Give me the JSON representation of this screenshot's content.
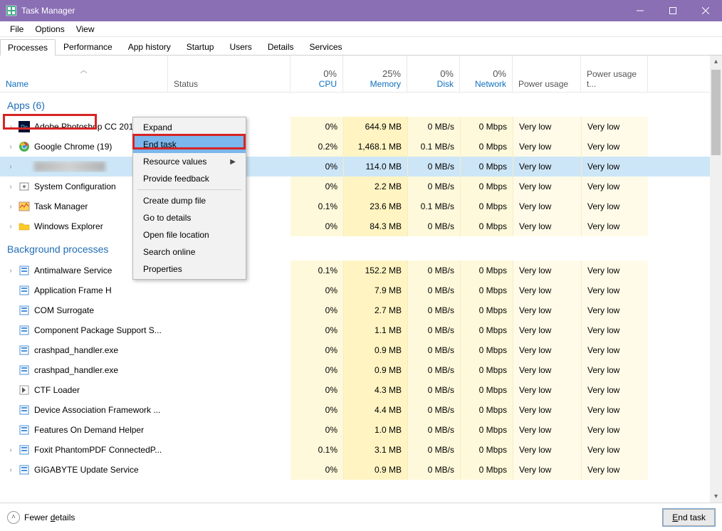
{
  "window": {
    "title": "Task Manager"
  },
  "menu": {
    "file": "File",
    "options": "Options",
    "view": "View"
  },
  "tabs": {
    "processes": "Processes",
    "performance": "Performance",
    "apphistory": "App history",
    "startup": "Startup",
    "users": "Users",
    "details": "Details",
    "services": "Services"
  },
  "columns": {
    "name": "Name",
    "status": "Status",
    "cpu": {
      "pct": "0%",
      "label": "CPU"
    },
    "memory": {
      "pct": "25%",
      "label": "Memory"
    },
    "disk": {
      "pct": "0%",
      "label": "Disk"
    },
    "network": {
      "pct": "0%",
      "label": "Network"
    },
    "power": "Power usage",
    "powertrend": "Power usage t..."
  },
  "groups": {
    "apps": "Apps (6)",
    "bg": "Background processes"
  },
  "rows": {
    "apps": [
      {
        "name": "Adobe Photoshop CC 2014 (2)",
        "cpu": "0%",
        "mem": "644.9 MB",
        "disk": "0 MB/s",
        "net": "0 Mbps",
        "pu": "Very low",
        "put": "Very low",
        "expand": true,
        "icon": "ps"
      },
      {
        "name": "Google Chrome (19)",
        "cpu": "0.2%",
        "mem": "1,468.1 MB",
        "disk": "0.1 MB/s",
        "net": "0 Mbps",
        "pu": "Very low",
        "put": "Very low",
        "expand": true,
        "icon": "chrome"
      },
      {
        "name": "",
        "cpu": "0%",
        "mem": "114.0 MB",
        "disk": "0 MB/s",
        "net": "0 Mbps",
        "pu": "Very low",
        "put": "Very low",
        "expand": true,
        "selected": true,
        "blurred": true,
        "icon": "blur"
      },
      {
        "name": "System Configuration",
        "cpu": "0%",
        "mem": "2.2 MB",
        "disk": "0 MB/s",
        "net": "0 Mbps",
        "pu": "Very low",
        "put": "Very low",
        "expand": true,
        "icon": "gear"
      },
      {
        "name": "Task Manager",
        "cpu": "0.1%",
        "mem": "23.6 MB",
        "disk": "0.1 MB/s",
        "net": "0 Mbps",
        "pu": "Very low",
        "put": "Very low",
        "expand": true,
        "icon": "tm"
      },
      {
        "name": "Windows Explorer",
        "cpu": "0%",
        "mem": "84.3 MB",
        "disk": "0 MB/s",
        "net": "0 Mbps",
        "pu": "Very low",
        "put": "Very low",
        "expand": true,
        "icon": "folder"
      }
    ],
    "bg": [
      {
        "name": "Antimalware Service",
        "cpu": "0.1%",
        "mem": "152.2 MB",
        "disk": "0 MB/s",
        "net": "0 Mbps",
        "pu": "Very low",
        "put": "Very low",
        "expand": true,
        "icon": "sq"
      },
      {
        "name": "Application Frame H",
        "cpu": "0%",
        "mem": "7.9 MB",
        "disk": "0 MB/s",
        "net": "0 Mbps",
        "pu": "Very low",
        "put": "Very low",
        "icon": "sq"
      },
      {
        "name": "COM Surrogate",
        "cpu": "0%",
        "mem": "2.7 MB",
        "disk": "0 MB/s",
        "net": "0 Mbps",
        "pu": "Very low",
        "put": "Very low",
        "icon": "sq"
      },
      {
        "name": "Component Package Support S...",
        "cpu": "0%",
        "mem": "1.1 MB",
        "disk": "0 MB/s",
        "net": "0 Mbps",
        "pu": "Very low",
        "put": "Very low",
        "icon": "sq"
      },
      {
        "name": "crashpad_handler.exe",
        "cpu": "0%",
        "mem": "0.9 MB",
        "disk": "0 MB/s",
        "net": "0 Mbps",
        "pu": "Very low",
        "put": "Very low",
        "icon": "sq"
      },
      {
        "name": "crashpad_handler.exe",
        "cpu": "0%",
        "mem": "0.9 MB",
        "disk": "0 MB/s",
        "net": "0 Mbps",
        "pu": "Very low",
        "put": "Very low",
        "icon": "sq"
      },
      {
        "name": "CTF Loader",
        "cpu": "0%",
        "mem": "4.3 MB",
        "disk": "0 MB/s",
        "net": "0 Mbps",
        "pu": "Very low",
        "put": "Very low",
        "icon": "ctf"
      },
      {
        "name": "Device Association Framework ...",
        "cpu": "0%",
        "mem": "4.4 MB",
        "disk": "0 MB/s",
        "net": "0 Mbps",
        "pu": "Very low",
        "put": "Very low",
        "icon": "sq"
      },
      {
        "name": "Features On Demand Helper",
        "cpu": "0%",
        "mem": "1.0 MB",
        "disk": "0 MB/s",
        "net": "0 Mbps",
        "pu": "Very low",
        "put": "Very low",
        "icon": "sq"
      },
      {
        "name": "Foxit PhantomPDF ConnectedP...",
        "cpu": "0.1%",
        "mem": "3.1 MB",
        "disk": "0 MB/s",
        "net": "0 Mbps",
        "pu": "Very low",
        "put": "Very low",
        "expand": true,
        "icon": "sq"
      },
      {
        "name": "GIGABYTE Update Service",
        "cpu": "0%",
        "mem": "0.9 MB",
        "disk": "0 MB/s",
        "net": "0 Mbps",
        "pu": "Very low",
        "put": "Very low",
        "expand": true,
        "icon": "sq"
      }
    ]
  },
  "context": {
    "items": [
      "Expand",
      "End task",
      "Resource values",
      "Provide feedback",
      "Create dump file",
      "Go to details",
      "Open file location",
      "Search online",
      "Properties"
    ]
  },
  "footer": {
    "fewer": "Fewer details",
    "endtask": "End task"
  }
}
